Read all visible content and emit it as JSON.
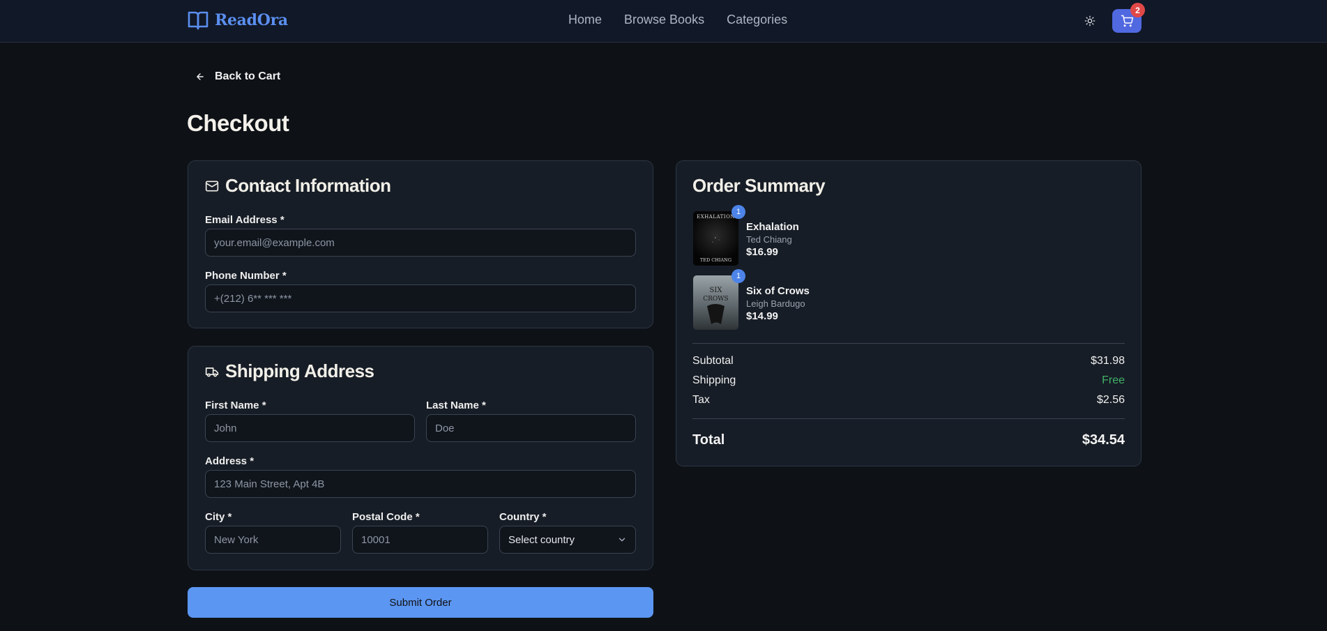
{
  "header": {
    "brand": "ReadOra",
    "nav": [
      "Home",
      "Browse Books",
      "Categories"
    ],
    "cart_count": "2",
    "icons": {
      "logo": "book-open-icon",
      "theme": "sun-icon",
      "cart": "cart-icon"
    },
    "colors": {
      "brand": "#5b8ff0",
      "cart_button": "#5068e0",
      "badge": "#e04848"
    }
  },
  "back_link": "Back to Cart",
  "page_title": "Checkout",
  "contact": {
    "title": "Contact Information",
    "email_label": "Email Address *",
    "email_placeholder": "your.email@example.com",
    "phone_label": "Phone Number *",
    "phone_placeholder": "+(212) 6** *** ***"
  },
  "shipping": {
    "title": "Shipping Address",
    "first_name_label": "First Name *",
    "first_name_placeholder": "John",
    "last_name_label": "Last Name *",
    "last_name_placeholder": "Doe",
    "address_label": "Address *",
    "address_placeholder": "123 Main Street, Apt 4B",
    "city_label": "City *",
    "city_placeholder": "New York",
    "postal_label": "Postal Code *",
    "postal_placeholder": "10001",
    "country_label": "Country *",
    "country_value": "Select country"
  },
  "submit_label": "Submit Order",
  "summary": {
    "title": "Order Summary",
    "items": [
      {
        "title": "Exhalation",
        "author": "Ted Chiang",
        "price": "$16.99",
        "qty": "1"
      },
      {
        "title": "Six of Crows",
        "author": "Leigh Bardugo",
        "price": "$14.99",
        "qty": "1"
      }
    ],
    "subtotal_label": "Subtotal",
    "subtotal_value": "$31.98",
    "shipping_label": "Shipping",
    "shipping_value": "Free",
    "tax_label": "Tax",
    "tax_value": "$2.56",
    "total_label": "Total",
    "total_value": "$34.54",
    "colors": {
      "free": "#3fb168",
      "submit": "#5b96f2"
    }
  }
}
